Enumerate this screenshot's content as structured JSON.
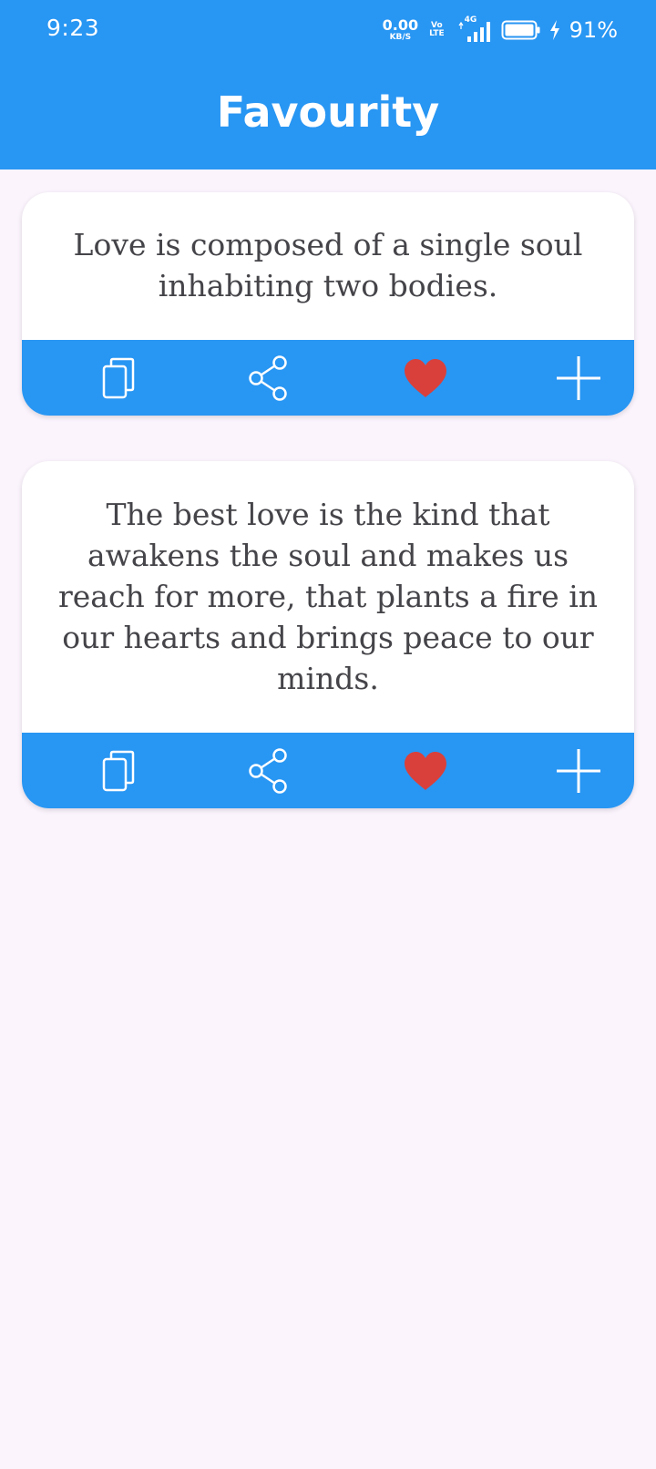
{
  "status_bar": {
    "time": "9:23",
    "net_speed_value": "0.00",
    "net_speed_unit": "KB/S",
    "volte_top": "Vo",
    "volte_bottom": "LTE",
    "network_type": "4G",
    "battery_percent": "91%"
  },
  "app_bar": {
    "title": "Favourity"
  },
  "quotes": [
    {
      "text": "Love is composed of a single soul inhabiting two bodies.",
      "favorited": true
    },
    {
      "text": "The best love is the kind that awakens the soul and makes us reach for more, that plants a fire in our hearts and brings peace to our minds.",
      "favorited": true
    }
  ],
  "actions": {
    "copy_icon": "copy-icon",
    "share_icon": "share-icon",
    "favorite_icon": "heart-icon",
    "add_icon": "plus-icon"
  },
  "colors": {
    "primary": "#2896f3",
    "background": "#fbf4fd",
    "heart": "#d9403b",
    "quote_text": "#444449"
  }
}
